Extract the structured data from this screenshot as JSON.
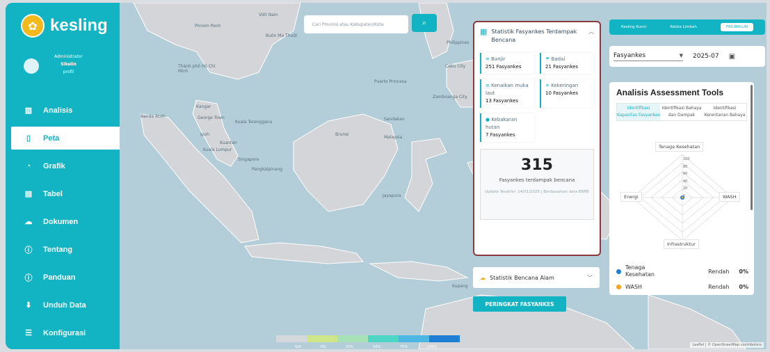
{
  "brand": {
    "name": "kesling",
    "badge": "✿"
  },
  "user": {
    "role": "Administrator",
    "name": "Sikelin",
    "profile": "profil"
  },
  "nav": [
    {
      "label": "Analisis",
      "icon": "▥"
    },
    {
      "label": "Peta",
      "icon": "▯"
    },
    {
      "label": "Grafik",
      "icon": "◔"
    },
    {
      "label": "Tabel",
      "icon": "▤"
    },
    {
      "label": "Dokumen",
      "icon": "☁"
    },
    {
      "label": "Tentang",
      "icon": "ⓘ"
    },
    {
      "label": "Panduan",
      "icon": "ⓘ"
    },
    {
      "label": "Unduh Data",
      "icon": "⬇"
    },
    {
      "label": "Konfigurasi",
      "icon": "☰"
    }
  ],
  "search": {
    "placeholder": "Cari Provinsi atau Kabupaten/Kota",
    "icon": "search-icon"
  },
  "map_labels": {
    "vietnam": "Việt Nam",
    "phnom_penh": "Phnom Penh",
    "thanh_pho": "Thành phố Hồ Chí Minh",
    "buon_ma_thuot": "Buôn Ma Thuột",
    "philippines": "Philippines",
    "cebu": "Cebu City",
    "puerto_princesa": "Puerto Princesa",
    "zamboanga": "Zamboanga City",
    "kangar": "Kangar",
    "george_town": "George Town",
    "kuala_terengganu": "Kuala Terengganu",
    "banda_aceh": "Banda Aceh",
    "kuantan": "Kuantan",
    "kuala_lumpur": "Kuala Lumpur",
    "singapore": "Singapore",
    "brunei": "Brunei",
    "sandakan": "Sandakan",
    "malaysia": "Malaysia",
    "pangkalpinang": "Pangkalpinang",
    "jayapura": "Jayapura",
    "kupang": "Kupang",
    "ipoh": "Ipoh"
  },
  "legend_ticks": [
    "N/A",
    "0%",
    "25%",
    "50%",
    "75%",
    "100%"
  ],
  "legend_colors": [
    "#d4d8dc",
    "#cfe58a",
    "#a8e0b8",
    "#4dd6c6",
    "#4cb7e3",
    "#1f7fd4"
  ],
  "attribution": "Leaflet | © OpenStreetMap contributors",
  "stat_panel": {
    "title": "Statistik Fasyankes Terdampak Bencana",
    "cards": [
      {
        "label": "Banjir",
        "icon": "flood-icon",
        "value": "251 Fasyankes"
      },
      {
        "label": "Badai",
        "icon": "storm-icon",
        "value": "21 Fasyankes"
      },
      {
        "label": "Kenaikan muka laut",
        "icon": "sea-level-icon",
        "value": "13 Fasyankes"
      },
      {
        "label": "Kekeringan",
        "icon": "drought-icon",
        "value": "10 Fasyankes"
      },
      {
        "label": "Kebakaran hutan",
        "icon": "fire-icon",
        "value": "7 Fasyankes"
      }
    ],
    "total": "315",
    "total_desc": "Fasyankes terdampak bencana",
    "update": "Update Terakhir: 14/01/2025 | Berdasarkan data BNPB"
  },
  "disaster_panel": {
    "title": "Statistik Bencana Alam"
  },
  "rank_button": "PERINGKAT FASYANKES",
  "top_tabs": [
    "Kesling Kunci",
    "Kelola Limbah",
    "FAS-BIK-LIN"
  ],
  "filters": {
    "type": "Fasyankes",
    "period": "2025-07"
  },
  "aat": {
    "title": "Analisis Assessment Tools",
    "tabs": [
      "Identifikasi Kapasitas Fasyankes",
      "Identifikasi Bahaya dan Dampak",
      "Identifikasi Kerentanan Bahaya"
    ],
    "axes": [
      "Tenaga Kesehatan",
      "WASH",
      "Infrastruktur",
      "Energi"
    ],
    "ticks": [
      "100",
      "80",
      "60",
      "40",
      "20",
      "0"
    ],
    "rows": [
      {
        "name": "Tenaga Kesehatan",
        "level": "Rendah",
        "pct": "0%",
        "color": "#1f7fd4"
      },
      {
        "name": "WASH",
        "level": "Rendah",
        "pct": "0%",
        "color": "#f4a51c"
      }
    ]
  }
}
